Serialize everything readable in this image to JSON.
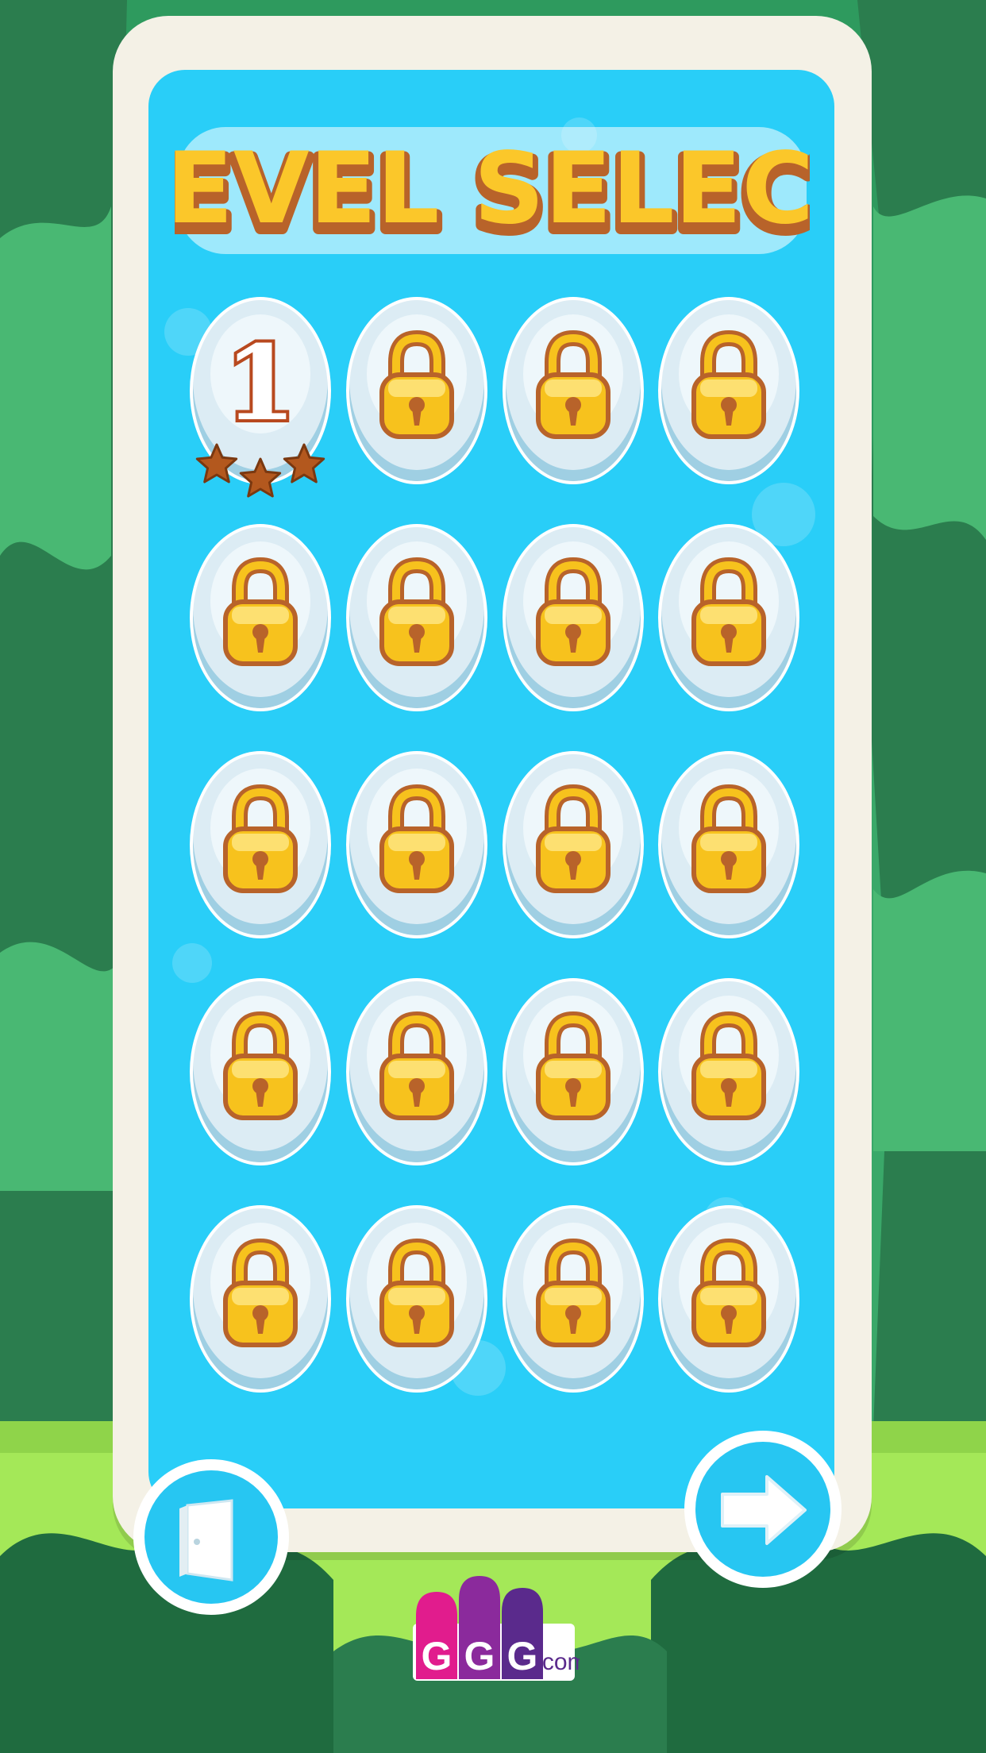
{
  "screen": {
    "title": "LEVEL SELECT"
  },
  "colors": {
    "panel_blue": "#29cef8",
    "frame_cream": "#f4f1e6",
    "lock_gold": "#f7c21d",
    "lock_outline": "#b8632a",
    "star_brown": "#b3581e",
    "jungle_green": "#2f8f5b",
    "grass_green": "#a4e858"
  },
  "levels": [
    {
      "number": "1",
      "locked": false,
      "stars_earned": 0,
      "stars_total": 3
    },
    {
      "locked": true
    },
    {
      "locked": true
    },
    {
      "locked": true
    },
    {
      "locked": true
    },
    {
      "locked": true
    },
    {
      "locked": true
    },
    {
      "locked": true
    },
    {
      "locked": true
    },
    {
      "locked": true
    },
    {
      "locked": true
    },
    {
      "locked": true
    },
    {
      "locked": true
    },
    {
      "locked": true
    },
    {
      "locked": true
    },
    {
      "locked": true
    },
    {
      "locked": true
    },
    {
      "locked": true
    },
    {
      "locked": true
    },
    {
      "locked": true
    }
  ],
  "controls": {
    "exit_icon": "door-icon",
    "next_icon": "arrow-right-icon"
  },
  "branding": {
    "logo_letters": [
      "G",
      "G",
      "G"
    ],
    "logo_suffix": ".com",
    "logo_letter_colors": [
      "#e11c8d",
      "#8b2a9c",
      "#5a2a8c"
    ]
  }
}
